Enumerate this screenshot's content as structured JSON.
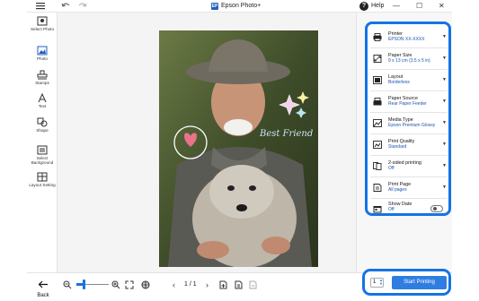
{
  "window": {
    "title": "Epson Photo+",
    "app_badge": "EP",
    "help_label": "Help",
    "accent_color": "#1473e6"
  },
  "left_tools": [
    {
      "icon": "select-photo-icon",
      "label": "Select Photo"
    },
    {
      "icon": "photo-icon",
      "label": "Photo"
    },
    {
      "icon": "stamp-icon",
      "label": "Stamps"
    },
    {
      "icon": "text-icon",
      "label": "Text"
    },
    {
      "icon": "shape-icon",
      "label": "Shape"
    },
    {
      "icon": "background-icon",
      "label": "Select Background"
    },
    {
      "icon": "layout-icon",
      "label": "Layout Setting"
    }
  ],
  "photo": {
    "overlay_text": "Best Friend"
  },
  "settings": [
    {
      "icon": "printer-icon",
      "title": "Printer",
      "value": "EPSON XX-XXXX"
    },
    {
      "icon": "paper-size-icon",
      "title": "Paper Size",
      "value": "9 x 13 cm (3.5 x 5 in)"
    },
    {
      "icon": "layout-icon",
      "title": "Layout",
      "value": "Borderless"
    },
    {
      "icon": "paper-source-icon",
      "title": "Paper Source",
      "value": "Rear Paper Feeder"
    },
    {
      "icon": "media-type-icon",
      "title": "Media Type",
      "value": "Epson Premium Glossy"
    },
    {
      "icon": "print-quality-icon",
      "title": "Print Quality",
      "value": "Standard"
    },
    {
      "icon": "two-sided-icon",
      "title": "2-sided printing",
      "value": "Off"
    },
    {
      "icon": "print-page-icon",
      "title": "Print Page",
      "value": "All pages"
    },
    {
      "icon": "show-date-icon",
      "title": "Show Date",
      "value": "Off"
    }
  ],
  "bottombar": {
    "back_label": "Back",
    "page_indicator": "1 / 1",
    "zoom_level": 0.25
  },
  "print": {
    "copies": "1",
    "start_label": "Start Printing"
  }
}
